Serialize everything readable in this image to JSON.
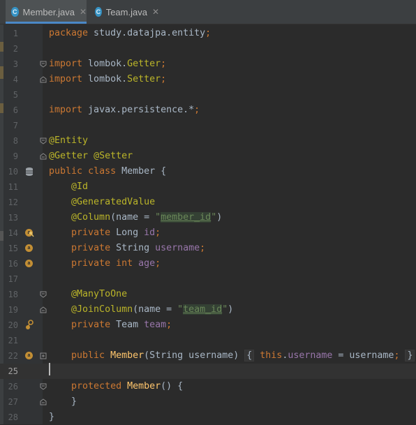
{
  "tabs": [
    {
      "label": "Member.java",
      "icon": "class-icon",
      "active": true
    },
    {
      "label": "Team.java",
      "icon": "class-icon",
      "active": false
    }
  ],
  "code_lines": [
    {
      "n": "1",
      "text": "package study.datajpa.entity;"
    },
    {
      "n": "2",
      "text": ""
    },
    {
      "n": "3",
      "text": "import lombok.Getter;"
    },
    {
      "n": "4",
      "text": "import lombok.Setter;"
    },
    {
      "n": "5",
      "text": ""
    },
    {
      "n": "6",
      "text": "import javax.persistence.*;"
    },
    {
      "n": "7",
      "text": ""
    },
    {
      "n": "8",
      "text": "@Entity"
    },
    {
      "n": "9",
      "text": "@Getter @Setter"
    },
    {
      "n": "10",
      "text": "public class Member {"
    },
    {
      "n": "11",
      "text": "    @Id"
    },
    {
      "n": "12",
      "text": "    @GeneratedValue"
    },
    {
      "n": "13",
      "text": "    @Column(name = \"member_id\")"
    },
    {
      "n": "14",
      "text": "    private Long id;"
    },
    {
      "n": "15",
      "text": "    private String username;"
    },
    {
      "n": "16",
      "text": "    private int age;"
    },
    {
      "n": "17",
      "text": ""
    },
    {
      "n": "18",
      "text": "    @ManyToOne"
    },
    {
      "n": "19",
      "text": "    @JoinColumn(name = \"team_id\")"
    },
    {
      "n": "20",
      "text": "    private Team team;"
    },
    {
      "n": "21",
      "text": ""
    },
    {
      "n": "22",
      "text": "    public Member(String username) { this.username = username; }"
    },
    {
      "n": "25",
      "text": ""
    },
    {
      "n": "26",
      "text": "    protected Member() {"
    },
    {
      "n": "27",
      "text": "    }"
    },
    {
      "n": "28",
      "text": "}"
    }
  ],
  "current_line": "25",
  "colors": {
    "keyword": "#cc7832",
    "annotation": "#bbb529",
    "string": "#6a8759",
    "field": "#9876aa",
    "method": "#ffc66d",
    "default": "#a9b7c6",
    "background": "#2b2b2b"
  }
}
